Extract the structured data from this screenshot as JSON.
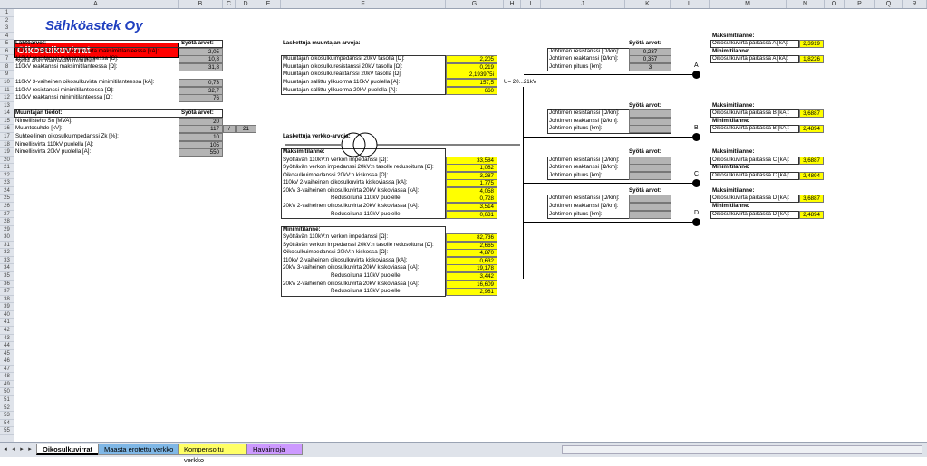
{
  "columns": [
    "A",
    "B",
    "C",
    "D",
    "E",
    "F",
    "G",
    "H",
    "I",
    "J",
    "K",
    "L",
    "M",
    "N",
    "O",
    "P",
    "Q",
    "R"
  ],
  "rows": [
    "1",
    "2",
    "3",
    "4",
    "5",
    "6",
    "7",
    "8",
    "9",
    "10",
    "11",
    "12",
    "13",
    "14",
    "15",
    "16",
    "17",
    "18",
    "19",
    "20",
    "21",
    "22",
    "23",
    "24",
    "25",
    "26",
    "27",
    "28",
    "29",
    "30",
    "31",
    "32",
    "33",
    "34",
    "35",
    "36",
    "37",
    "38",
    "39",
    "40",
    "41",
    "42",
    "43",
    "44",
    "45",
    "46",
    "47",
    "48",
    "49",
    "50",
    "51",
    "52",
    "53",
    "54",
    "55"
  ],
  "company": "Sähköastek Oy",
  "sheet_title": "Oikosulkuvirrat",
  "instruction": "Syötä arvot harmaisiin ruutuihin!",
  "lahto": {
    "header": "Lähtöarvot:",
    "input_header": "Syötä arvot:",
    "rows": [
      {
        "label": "110kV 3-vaiheinen oikosulkuvirta maksimitilanteessa [kA]:",
        "value": "2,05"
      },
      {
        "label": "110kV resistanssi maksimitilanteessa [Ω]:",
        "value": "10,8"
      },
      {
        "label": "110kV reaktanssi maksimitilanteessa [Ω]:",
        "value": "31,8"
      },
      {
        "label": "110kV 3-vaiheinen oikosulkuvirta minimitilanteessa [kA]:",
        "value": "0,73"
      },
      {
        "label": "110kV resistanssi minimitilanteessa [Ω]:",
        "value": "32,7"
      },
      {
        "label": "110kV reaktanssi minimitilanteessa [Ω]:",
        "value": "76"
      }
    ]
  },
  "muuntaja": {
    "header": "Muuntajan tiedot:",
    "input_header": "Syötä arvot:",
    "rows": [
      {
        "label": "Nimellisteho Sn [MVA]:",
        "value": "20"
      },
      {
        "label": "Muuntosuhde [kV]:",
        "value": "117"
      },
      {
        "label": "Suhteellinen oikosulkuimpedanssi Zk [%]:",
        "value": "10"
      },
      {
        "label": "Nimellisvirta 110kV puolella [A]:",
        "value": "105"
      },
      {
        "label": "Nimellisvirta 20kV puolella [A]:",
        "value": "550"
      }
    ],
    "ratio_sep": "/",
    "ratio_second": "21"
  },
  "lask_muuntaja": {
    "header": "Laskettuja muuntajan arvoja:",
    "rows": [
      {
        "label": "Muuntajan oikosulkuimpedanssi 20kV tasolla [Ω]:",
        "value": "2,205"
      },
      {
        "label": "Muuntajan oikosulkuresistanssi 20kV tasolla [Ω]:",
        "value": "0,219"
      },
      {
        "label": "Muuntajan oikosulkureaktanssi 20kV tasolla [Ω]:",
        "value": "2,193975i"
      },
      {
        "label": "Muuntajan sallittu ylikuorma 110kV puolella [A]:",
        "value": "157,5"
      },
      {
        "label": "Muuntajan sallittu ylikuorma 20kV puolella [A]:",
        "value": "660"
      }
    ]
  },
  "bus_label": "U= 20...21kV",
  "lask_verkko": "Laskettuja verkko-arvoja:",
  "maks": {
    "header": "Maksimitilanne:",
    "rows": [
      {
        "label": "Syöttävän 110kV:n verkon impedanssi [Ω]:",
        "value": "33,584"
      },
      {
        "label": "Syöttävän verkon impedanssi 20kV:n tasolle redusoituna [Ω]:",
        "value": "1,082"
      },
      {
        "label": "Oikosulkuimpedanssi 20kV:n kiskossa [Ω]:",
        "value": "3,287"
      },
      {
        "label": "110kV 2-vaiheinen oikosulkuvirta kiskoviassa [kA]:",
        "value": "1,775"
      },
      {
        "label": "20kV 3-vaiheinen oikosulkuvirta 20kV kiskoviassa [kA]:",
        "value": "4,058"
      },
      {
        "label": "Redusoituna 110kV puolelle:",
        "value": "0,728"
      },
      {
        "label": "20kV 2-vaiheinen oikosulkuvirta 20kV kiskoviassa [kA]:",
        "value": "3,514"
      },
      {
        "label": "Redusoituna 110kV puolelle:",
        "value": "0,631"
      }
    ]
  },
  "mini": {
    "header": "Minimitilanne:",
    "rows": [
      {
        "label": "Syöttävän 110kV:n verkon impedanssi [Ω]:",
        "value": "82,736"
      },
      {
        "label": "Syöttävän verkon impedanssi 20kV:n tasolle redusoituna [Ω]:",
        "value": "2,665"
      },
      {
        "label": "Oikosulkuimpedanssi 20kV:n kiskossa [Ω]:",
        "value": "4,870"
      },
      {
        "label": "110kV 2-vaiheinen oikosulkuvirta kiskoviassa [kA]:",
        "value": "0,632"
      },
      {
        "label": "20kV 3-vaiheinen oikosulkuvirta 20kV kiskoviassa [kA]:",
        "value": "19,178"
      },
      {
        "label": "Redusoituna 110kV puolelle:",
        "value": "3,442"
      },
      {
        "label": "20kV 2-vaiheinen oikosulkuvirta 20kV kiskoviassa [kA]:",
        "value": "16,609"
      },
      {
        "label": "Redusoituna 110kV puolelle:",
        "value": "2,981"
      }
    ]
  },
  "feeders": [
    {
      "input_header": "Syötä arvot:",
      "res_label": "Johtimen resistanssi [Ω/km]:",
      "res": "0,237",
      "reac_label": "Johtimen reaktanssi [Ω/km]:",
      "reac": "0,357",
      "len_label": "Johtimen pituus [km]:",
      "len": "3",
      "point": "A",
      "max_header": "Maksimitilanne:",
      "max_label": "Oikosulkuvirta paikassa A [kA]:",
      "max": "2,3919",
      "min_header": "Minimitilanne:",
      "min_label": "Oikosulkuvirta paikassa A [kA]:",
      "min": "1,8226"
    },
    {
      "input_header": "Syötä arvot:",
      "res_label": "Johtimen resistanssi [Ω/km]:",
      "res": "",
      "reac_label": "Johtimen reaktanssi [Ω/km]:",
      "reac": "",
      "len_label": "Johtimen pituus [km]:",
      "len": "",
      "point": "B",
      "max_header": "Maksimitilanne:",
      "max_label": "Oikosulkuvirta paikassa B [kA]:",
      "max": "3,6887",
      "min_header": "Minimitilanne:",
      "min_label": "Oikosulkuvirta paikassa B [kA]:",
      "min": "2,4894"
    },
    {
      "input_header": "Syötä arvot:",
      "res_label": "Johtimen resistanssi [Ω/km]:",
      "res": "",
      "reac_label": "Johtimen reaktanssi [Ω/km]:",
      "reac": "",
      "len_label": "Johtimen pituus [km]:",
      "len": "",
      "point": "C",
      "max_header": "Maksimitilanne:",
      "max_label": "Oikosulkuvirta paikassa C [kA]:",
      "max": "3,6887",
      "min_header": "Minimitilanne:",
      "min_label": "Oikosulkuvirta paikassa C [kA]:",
      "min": "2,4894"
    },
    {
      "input_header": "Syötä arvot:",
      "res_label": "Johtimen resistanssi [Ω/km]:",
      "res": "",
      "reac_label": "Johtimen reaktanssi [Ω/km]:",
      "reac": "",
      "len_label": "Johtimen pituus [km]:",
      "len": "",
      "point": "D",
      "max_header": "Maksimitilanne:",
      "max_label": "Oikosulkuvirta paikassa D [kA]:",
      "max": "3,6887",
      "min_header": "Minimitilanne:",
      "min_label": "Oikosulkuvirta paikassa D [kA]:",
      "min": "2,4894"
    }
  ],
  "tabs": [
    {
      "label": "Oikosulkuvirrat",
      "color": "#ffffff",
      "active": true
    },
    {
      "label": "Maasta erotettu verkko",
      "color": "#7fb7e6",
      "active": false
    },
    {
      "label": "Kompensoitu verkko",
      "color": "#ffff66",
      "active": false
    },
    {
      "label": "Havaintoja",
      "color": "#cc99ff",
      "active": false
    }
  ],
  "colors": {
    "title_red": "#ff0000",
    "company_blue": "#1f3fbf",
    "input_gray": "#b4b4b4",
    "result_yellow": "#ffff00"
  }
}
